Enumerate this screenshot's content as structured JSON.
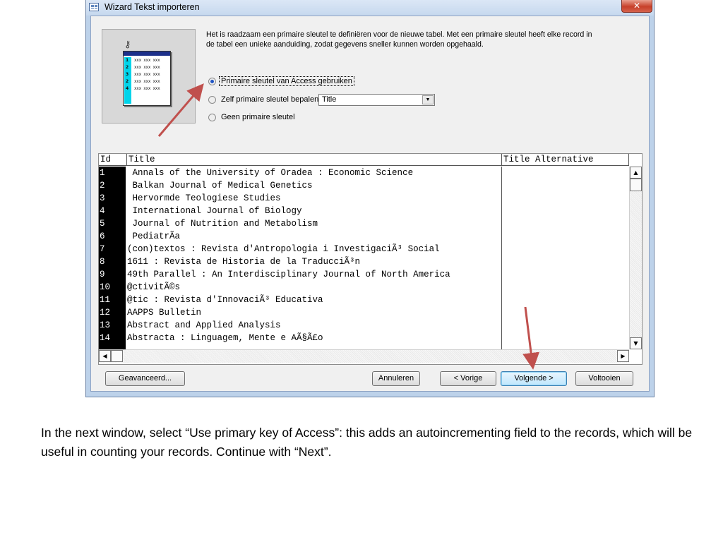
{
  "window": {
    "title": "Wizard Tekst importeren",
    "close_glyph": "✕"
  },
  "illustration": {
    "key_glyph": "⚷",
    "rows": [
      {
        "n": "1",
        "x": "xxx xxx xxx"
      },
      {
        "n": "2",
        "x": "xxx xxx xxx"
      },
      {
        "n": "3",
        "x": "xxx xxx xxx"
      },
      {
        "n": "2",
        "x": "xxx xxx xxx"
      },
      {
        "n": "4",
        "x": "xxx xxx xxx"
      }
    ]
  },
  "info_text": "Het is raadzaam een primaire sleutel te definiëren voor de nieuwe tabel. Met een primaire sleutel heeft elke record in de tabel een unieke aanduiding, zodat gegevens sneller kunnen worden opgehaald.",
  "radios": {
    "option1": {
      "label": "Primaire sleutel van Access gebruiken",
      "selected": true
    },
    "option2": {
      "label": "Zelf primaire sleutel bepalen",
      "selected": false
    },
    "option3": {
      "label": "Geen primaire sleutel",
      "selected": false
    }
  },
  "key_combo": {
    "value": "Title",
    "arrow_glyph": "▼"
  },
  "grid": {
    "columns": [
      "Id",
      "Title",
      "Title Alternative"
    ],
    "rows": [
      {
        "id": "1",
        "title": " Annals of the University of Oradea : Economic Science"
      },
      {
        "id": "2",
        "title": " Balkan Journal of Medical Genetics"
      },
      {
        "id": "3",
        "title": " Hervormde Teologiese Studies"
      },
      {
        "id": "4",
        "title": " International Journal of Biology"
      },
      {
        "id": "5",
        "title": " Journal of Nutrition and Metabolism"
      },
      {
        "id": "6",
        "title": " PediatrÃ­a"
      },
      {
        "id": "7",
        "title": "(con)textos : Revista d'Antropologia i InvestigaciÃ³ Social"
      },
      {
        "id": "8",
        "title": "1611 : Revista de Historia de la TraducciÃ³n"
      },
      {
        "id": "9",
        "title": "49th Parallel : An Interdisciplinary Journal of North America"
      },
      {
        "id": "10",
        "title": "@ctivitÃ©s"
      },
      {
        "id": "11",
        "title": "@tic : Revista d'InnovaciÃ³ Educativa"
      },
      {
        "id": "12",
        "title": "AAPPS Bulletin"
      },
      {
        "id": "13",
        "title": "Abstract and Applied Analysis"
      },
      {
        "id": "14",
        "title": "Abstracta : Linguagem, Mente e AÃ§Ã£o"
      }
    ],
    "scroll_up": "▲",
    "scroll_down": "▼",
    "scroll_left": "◀",
    "scroll_right": "▶"
  },
  "buttons": {
    "advanced": "Geavanceerd...",
    "cancel": "Annuleren",
    "back": "< Vorige",
    "next": "Volgende >",
    "finish": "Voltooien"
  },
  "annotation_color": "#c0504d",
  "caption": "In the next window, select “Use primary key of Access”: this adds an autoincrementing field to the records, which will be useful in counting your records.  Continue with “Next”."
}
